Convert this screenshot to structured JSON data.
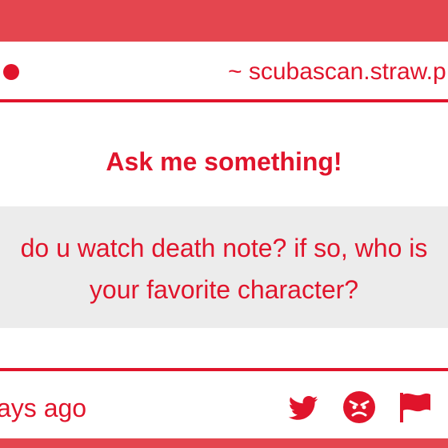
{
  "header": {
    "url_text": "~ scubascan.straw.p"
  },
  "main": {
    "title": "Ask me something!",
    "question": "do u watch death note? if so, who is your favorite character?"
  },
  "footer": {
    "time_text": "ays ago",
    "icons": [
      "twitter-icon",
      "angry-face-icon",
      "flag-icon"
    ]
  },
  "colors": {
    "accent": "#e0142b",
    "band": "#e4464f",
    "question_bg": "#ececec",
    "card_bg": "#ffffff"
  }
}
